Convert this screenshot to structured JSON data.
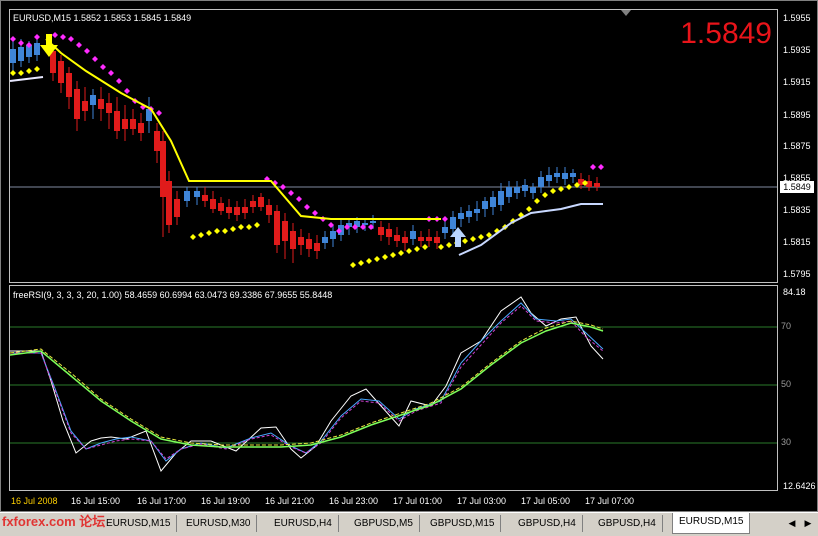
{
  "main_info": "EURUSD,M15  1.5852 1.5853 1.5845 1.5849",
  "big_price": "1.5849",
  "price_axis": [
    "1.5955",
    "1.5935",
    "1.5915",
    "1.5895",
    "1.5875",
    "1.5855",
    "1.5835",
    "1.5815",
    "1.5795"
  ],
  "current_price": "1.5849",
  "rsi_info": "freeRSI(9, 3, 3, 3, 20, 1.00) 58.4659 60.6994 63.0473 69.3386 67.9655 55.8448",
  "rsi_axis": {
    "top": "84.18",
    "l70": "70",
    "l50": "50",
    "l30": "30",
    "bottom": "12.6426"
  },
  "time_axis": [
    "16 Jul 2008",
    "16 Jul 15:00",
    "16 Jul 17:00",
    "16 Jul 19:00",
    "16 Jul 21:00",
    "16 Jul 23:00",
    "17 Jul 01:00",
    "17 Jul 03:00",
    "17 Jul 05:00",
    "17 Jul 07:00"
  ],
  "tabs": [
    "EURUSD,M15",
    "EURUSD,M30",
    "EURUSD,H4",
    "GBPUSD,M5",
    "GBPUSD,M15",
    "GBPUSD,H4",
    "GBPUSD,H4",
    "EURUSD,M15"
  ],
  "active_tab": 7,
  "watermark": "fxforex.com 论坛",
  "colors": {
    "up": "#3f85d8",
    "down": "#e01b1b",
    "yellow": "#ffff00",
    "magenta": "#ff2bff",
    "bg": "#000000"
  }
}
